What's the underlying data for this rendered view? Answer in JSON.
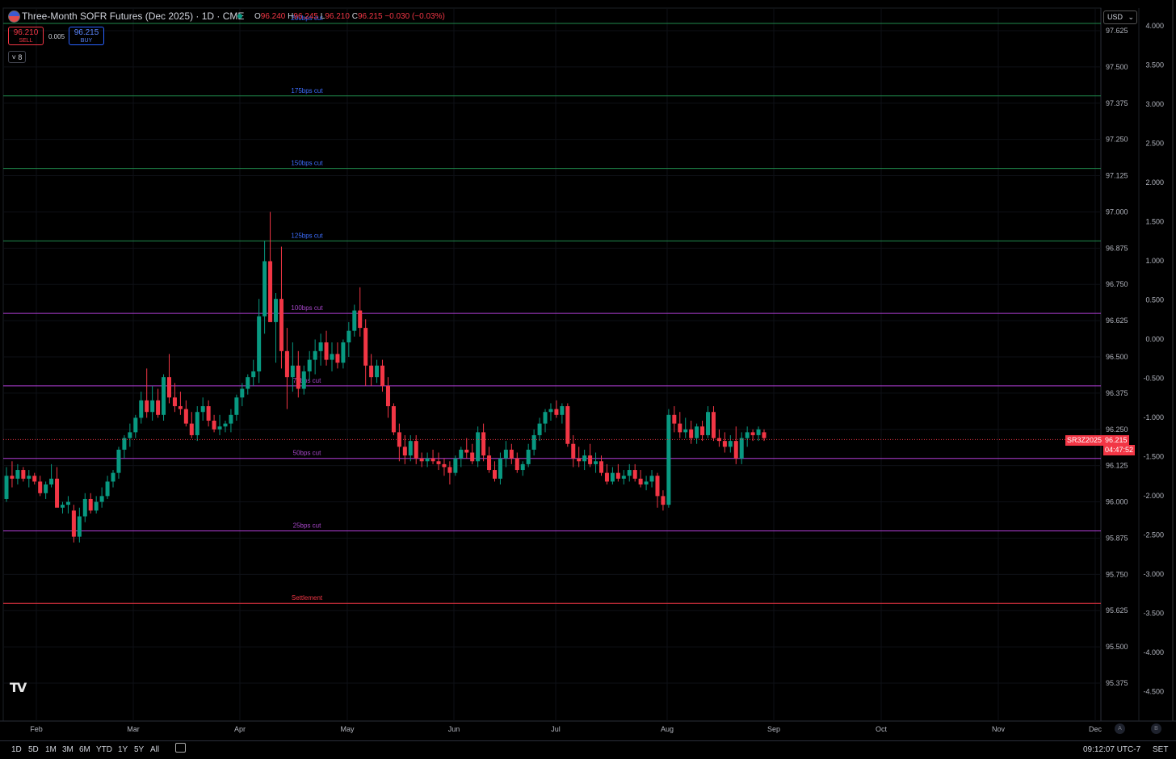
{
  "header": {
    "title": "Three-Month SOFR Futures (Dec 2025) · 1D · CME",
    "ohlc": [
      {
        "k": "O",
        "v": "96.240"
      },
      {
        "k": "H",
        "v": "96.245"
      },
      {
        "k": "L",
        "v": "96.210"
      },
      {
        "k": "C",
        "v": "96.215"
      },
      {
        "k": "",
        "v": "−0.030 (−0.03%)"
      }
    ],
    "sell_price": "96.210",
    "sell_label": "SELL",
    "buy_price": "96.215",
    "buy_label": "BUY",
    "spread": "0.005",
    "indicators_count": "8",
    "currency": "USD"
  },
  "price_tag": {
    "symbol": "SR3Z2025",
    "price": "96.215",
    "countdown": "04:47:52"
  },
  "bottom": {
    "ranges": [
      "1D",
      "5D",
      "1M",
      "3M",
      "6M",
      "YTD",
      "1Y",
      "5Y",
      "All"
    ],
    "time": "09:12:07 UTC-7",
    "session": "SET",
    "auto_label": "A",
    "log_label": "B"
  },
  "colors": {
    "up": "#089981",
    "down": "#f23645",
    "green_line": "#1f8a4c",
    "purple_line": "#b23fd8",
    "red_line": "#f23645"
  },
  "chart_data": {
    "type": "candlestick",
    "x_axis": {
      "labels": [
        "Feb",
        "Mar",
        "Apr",
        "May",
        "Jun",
        "Jul",
        "Aug",
        "Sep",
        "Oct",
        "Nov",
        "Dec"
      ]
    },
    "y_axis_price": {
      "range": [
        95.33,
        97.67
      ],
      "ticks": [
        "97.625",
        "97.500",
        "97.375",
        "97.250",
        "97.125",
        "97.000",
        "96.875",
        "96.750",
        "96.625",
        "96.500",
        "96.375",
        "96.250",
        "96.125",
        "96.000",
        "95.875",
        "95.750",
        "95.625",
        "95.500",
        "95.375"
      ]
    },
    "y_axis_pct": {
      "ticks": [
        "4.000",
        "3.500",
        "3.000",
        "2.500",
        "2.000",
        "1.500",
        "1.000",
        "0.500",
        "0.000",
        "-0.500",
        "-1.000",
        "-1.500",
        "-2.000",
        "-2.500",
        "-3.000",
        "-3.500",
        "-4.000",
        "-4.500"
      ]
    },
    "levels": [
      {
        "label": "200bps cut",
        "price": 97.65,
        "color": "green"
      },
      {
        "label": "175bps cut",
        "price": 97.4,
        "color": "green"
      },
      {
        "label": "150bps cut",
        "price": 97.15,
        "color": "green"
      },
      {
        "label": "125bps cut",
        "price": 96.9,
        "color": "green"
      },
      {
        "label": "100bps cut",
        "price": 96.65,
        "color": "purple"
      },
      {
        "label": "75bps cut",
        "price": 96.4,
        "color": "purple"
      },
      {
        "label": "50bps cut",
        "price": 96.15,
        "color": "purple"
      },
      {
        "label": "25bps cut",
        "price": 95.9,
        "color": "purple"
      },
      {
        "label": "Settlement",
        "price": 95.65,
        "color": "red"
      }
    ],
    "last_price": 96.215,
    "candles": [
      [
        96.01,
        96.12,
        96.0,
        96.09
      ],
      [
        96.09,
        96.14,
        96.05,
        96.08
      ],
      [
        96.08,
        96.13,
        96.06,
        96.11
      ],
      [
        96.11,
        96.12,
        96.07,
        96.08
      ],
      [
        96.08,
        96.11,
        96.05,
        96.09
      ],
      [
        96.09,
        96.1,
        96.06,
        96.07
      ],
      [
        96.07,
        96.09,
        96.02,
        96.03
      ],
      [
        96.03,
        96.07,
        96.01,
        96.06
      ],
      [
        96.06,
        96.13,
        96.05,
        96.08
      ],
      [
        96.08,
        96.12,
        95.99,
        95.98
      ],
      [
        95.98,
        96.0,
        95.96,
        95.99
      ],
      [
        95.99,
        96.02,
        95.96,
        96.0
      ],
      [
        95.97,
        95.99,
        95.86,
        95.88
      ],
      [
        95.88,
        95.98,
        95.86,
        95.95
      ],
      [
        95.95,
        96.03,
        95.93,
        96.01
      ],
      [
        96.01,
        96.03,
        95.96,
        95.97
      ],
      [
        95.97,
        96.02,
        95.96,
        96.0
      ],
      [
        96.0,
        96.05,
        95.98,
        96.02
      ],
      [
        96.02,
        96.09,
        96.01,
        96.07
      ],
      [
        96.07,
        96.11,
        96.05,
        96.1
      ],
      [
        96.1,
        96.19,
        96.08,
        96.18
      ],
      [
        96.18,
        96.23,
        96.15,
        96.22
      ],
      [
        96.22,
        96.27,
        96.19,
        96.24
      ],
      [
        96.24,
        96.3,
        96.22,
        96.29
      ],
      [
        96.29,
        96.38,
        96.27,
        96.35
      ],
      [
        96.35,
        96.46,
        96.29,
        96.31
      ],
      [
        96.31,
        96.4,
        96.28,
        96.35
      ],
      [
        96.35,
        96.39,
        96.29,
        96.3
      ],
      [
        96.3,
        96.44,
        96.28,
        96.43
      ],
      [
        96.43,
        96.51,
        96.34,
        96.36
      ],
      [
        96.36,
        96.41,
        96.31,
        96.33
      ],
      [
        96.33,
        96.38,
        96.3,
        96.32
      ],
      [
        96.32,
        96.35,
        96.26,
        96.27
      ],
      [
        96.27,
        96.31,
        96.22,
        96.23
      ],
      [
        96.23,
        96.33,
        96.21,
        96.31
      ],
      [
        96.31,
        96.36,
        96.28,
        96.33
      ],
      [
        96.33,
        96.35,
        96.26,
        96.28
      ],
      [
        96.28,
        96.3,
        96.24,
        96.25
      ],
      [
        96.25,
        96.3,
        96.23,
        96.26
      ],
      [
        96.26,
        96.28,
        96.24,
        96.27
      ],
      [
        96.27,
        96.32,
        96.24,
        96.3
      ],
      [
        96.3,
        96.37,
        96.28,
        96.36
      ],
      [
        96.36,
        96.41,
        96.33,
        96.39
      ],
      [
        96.39,
        96.44,
        96.37,
        96.43
      ],
      [
        96.43,
        96.49,
        96.4,
        96.45
      ],
      [
        96.45,
        96.7,
        96.41,
        96.64
      ],
      [
        96.64,
        96.9,
        96.58,
        96.83
      ],
      [
        96.83,
        97.0,
        96.66,
        96.62
      ],
      [
        96.62,
        96.72,
        96.48,
        96.7
      ],
      [
        96.7,
        96.88,
        96.46,
        96.52
      ],
      [
        96.52,
        96.6,
        96.32,
        96.43
      ],
      [
        96.43,
        96.55,
        96.38,
        96.47
      ],
      [
        96.47,
        96.52,
        96.36,
        96.39
      ],
      [
        96.39,
        96.47,
        96.37,
        96.45
      ],
      [
        96.45,
        96.52,
        96.42,
        96.49
      ],
      [
        96.49,
        96.56,
        96.44,
        96.52
      ],
      [
        96.52,
        96.58,
        96.47,
        96.55
      ],
      [
        96.55,
        96.59,
        96.47,
        96.49
      ],
      [
        96.49,
        96.55,
        96.45,
        96.51
      ],
      [
        96.51,
        96.55,
        96.46,
        96.48
      ],
      [
        96.48,
        96.56,
        96.46,
        96.55
      ],
      [
        96.55,
        96.62,
        96.5,
        96.59
      ],
      [
        96.59,
        96.68,
        96.57,
        96.66
      ],
      [
        96.66,
        96.74,
        96.57,
        96.6
      ],
      [
        96.6,
        96.63,
        96.4,
        96.47
      ],
      [
        96.47,
        96.51,
        96.4,
        96.43
      ],
      [
        96.43,
        96.49,
        96.41,
        96.47
      ],
      [
        96.47,
        96.49,
        96.38,
        96.4
      ],
      [
        96.4,
        96.43,
        96.29,
        96.33
      ],
      [
        96.33,
        96.34,
        96.23,
        96.24
      ],
      [
        96.24,
        96.27,
        96.14,
        96.19
      ],
      [
        96.19,
        96.23,
        96.13,
        96.16
      ],
      [
        96.16,
        96.23,
        96.14,
        96.21
      ],
      [
        96.21,
        96.23,
        96.13,
        96.15
      ],
      [
        96.15,
        96.17,
        96.12,
        96.14
      ],
      [
        96.14,
        96.17,
        96.12,
        96.15
      ],
      [
        96.15,
        96.18,
        96.13,
        96.14
      ],
      [
        96.14,
        96.17,
        96.11,
        96.13
      ],
      [
        96.13,
        96.15,
        96.09,
        96.12
      ],
      [
        96.12,
        96.14,
        96.06,
        96.1
      ],
      [
        96.1,
        96.16,
        96.09,
        96.15
      ],
      [
        96.15,
        96.19,
        96.12,
        96.18
      ],
      [
        96.18,
        96.22,
        96.15,
        96.17
      ],
      [
        96.17,
        96.2,
        96.13,
        96.14
      ],
      [
        96.14,
        96.26,
        96.12,
        96.24
      ],
      [
        96.24,
        96.27,
        96.14,
        96.16
      ],
      [
        96.16,
        96.19,
        96.1,
        96.11
      ],
      [
        96.11,
        96.14,
        96.07,
        96.08
      ],
      [
        96.08,
        96.17,
        96.06,
        96.15
      ],
      [
        96.15,
        96.21,
        96.12,
        96.18
      ],
      [
        96.18,
        96.2,
        96.13,
        96.15
      ],
      [
        96.15,
        96.17,
        96.1,
        96.11
      ],
      [
        96.11,
        96.14,
        96.09,
        96.13
      ],
      [
        96.13,
        96.2,
        96.12,
        96.18
      ],
      [
        96.18,
        96.25,
        96.16,
        96.23
      ],
      [
        96.23,
        96.29,
        96.21,
        96.27
      ],
      [
        96.27,
        96.32,
        96.24,
        96.31
      ],
      [
        96.31,
        96.34,
        96.28,
        96.32
      ],
      [
        96.32,
        96.35,
        96.29,
        96.3
      ],
      [
        96.3,
        96.34,
        96.27,
        96.33
      ],
      [
        96.33,
        96.34,
        96.19,
        96.2
      ],
      [
        96.2,
        96.23,
        96.12,
        96.15
      ],
      [
        96.15,
        96.19,
        96.12,
        96.14
      ],
      [
        96.14,
        96.18,
        96.11,
        96.16
      ],
      [
        96.16,
        96.2,
        96.12,
        96.13
      ],
      [
        96.13,
        96.17,
        96.1,
        96.14
      ],
      [
        96.14,
        96.16,
        96.09,
        96.1
      ],
      [
        96.1,
        96.13,
        96.06,
        96.07
      ],
      [
        96.07,
        96.12,
        96.06,
        96.1
      ],
      [
        96.1,
        96.13,
        96.07,
        96.08
      ],
      [
        96.08,
        96.11,
        96.06,
        96.09
      ],
      [
        96.09,
        96.13,
        96.07,
        96.11
      ],
      [
        96.11,
        96.13,
        96.07,
        96.08
      ],
      [
        96.08,
        96.11,
        96.05,
        96.06
      ],
      [
        96.06,
        96.09,
        96.04,
        96.07
      ],
      [
        96.07,
        96.11,
        96.05,
        96.09
      ],
      [
        96.09,
        96.1,
        95.98,
        96.02
      ],
      [
        96.02,
        96.04,
        95.97,
        95.99
      ],
      [
        95.99,
        96.32,
        95.98,
        96.3
      ],
      [
        96.3,
        96.33,
        96.24,
        96.27
      ],
      [
        96.27,
        96.31,
        96.22,
        96.24
      ],
      [
        96.24,
        96.29,
        96.22,
        96.25
      ],
      [
        96.25,
        96.28,
        96.2,
        96.22
      ],
      [
        96.22,
        96.27,
        96.2,
        96.26
      ],
      [
        96.26,
        96.28,
        96.21,
        96.23
      ],
      [
        96.23,
        96.33,
        96.22,
        96.31
      ],
      [
        96.31,
        96.33,
        96.21,
        96.22
      ],
      [
        96.22,
        96.25,
        96.19,
        96.21
      ],
      [
        96.21,
        96.24,
        96.17,
        96.19
      ],
      [
        96.19,
        96.23,
        96.17,
        96.21
      ],
      [
        96.21,
        96.26,
        96.13,
        96.15
      ],
      [
        96.15,
        96.24,
        96.13,
        96.22
      ],
      [
        96.22,
        96.26,
        96.19,
        96.24
      ],
      [
        96.24,
        96.25,
        96.21,
        96.23
      ],
      [
        96.23,
        96.26,
        96.21,
        96.25
      ],
      [
        96.24,
        96.25,
        96.21,
        96.22
      ]
    ]
  }
}
